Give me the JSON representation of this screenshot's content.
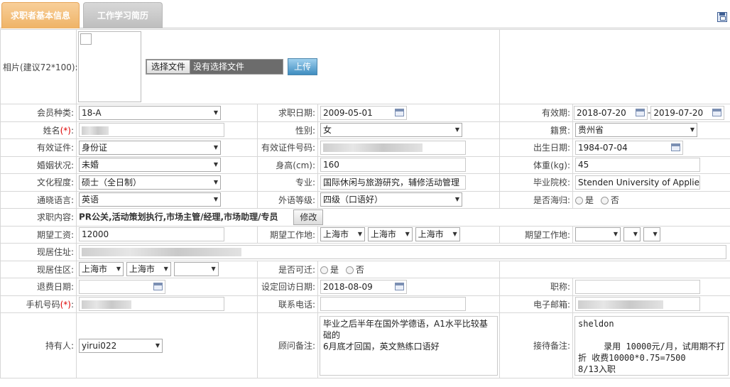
{
  "tabs": [
    "求职者基本信息",
    "工作学习简历"
  ],
  "labels": {
    "photo": "相片(建议72*100):",
    "member_type": "会员种类:",
    "job_date": "求职日期:",
    "validity": "有效期:",
    "name": "姓名",
    "gender": "性别:",
    "origin": "籍贯:",
    "id_type": "有效证件:",
    "id_number": "有效证件号码:",
    "birth": "出生日期:",
    "marital": "婚姻状况:",
    "height": "身高(cm):",
    "weight": "体重(kg):",
    "education": "文化程度:",
    "major": "专业:",
    "school": "毕业院校:",
    "language": "通晓语言:",
    "lang_level": "外语等级:",
    "returnee": "是否海归:",
    "job_content": "求职内容:",
    "salary": "期望工资:",
    "work_place": "期望工作地:",
    "work_place2": "期望工作地:",
    "address": "现居住址:",
    "district": "现居住区:",
    "relocate": "是否可迁:",
    "refund_date": "退费日期:",
    "revisit_date": "设定回访日期:",
    "title": "职称:",
    "mobile": "手机号码",
    "phone": "联系电话:",
    "email": "电子邮箱:",
    "owner": "持有人:",
    "advisor_note": "顾问备注:",
    "reception_note": "接待备注:"
  },
  "required_mark": "(*)",
  "photo": {
    "choose_file": "选择文件",
    "no_file": "没有选择文件",
    "upload": "上传"
  },
  "values": {
    "member_type": "18-A",
    "job_date": "2009-05-01",
    "validity_from": "2018-07-20",
    "validity_sep": "-",
    "validity_to": "2019-07-20",
    "gender": "女",
    "origin": "贵州省",
    "id_type": "身份证",
    "birth": "1984-07-04",
    "marital": "未婚",
    "height": "160",
    "weight": "45",
    "education": "硕士（全日制）",
    "major": "国际休闲与旅游研究，辅修活动管理",
    "school": "Stenden University of Applied",
    "language": "英语",
    "lang_level": "四级（口语好）",
    "job_content": "PR公关,活动策划执行,市场主管/经理,市场助理/专员",
    "modify": "修改",
    "salary": "12000",
    "work_place": [
      "上海市",
      "上海市",
      "上海市"
    ],
    "district": [
      "上海市",
      "上海市",
      ""
    ],
    "revisit_date": "2018-08-09",
    "owner": "yirui022",
    "advisor_note": "毕业之后半年在国外学德语，A1水平比较基础的\n6月底才回国，英文熟练口语好",
    "reception_note": "sheldon\n\n     录用 10000元/月，试用期不打折 收费10000*0.75=7500\n8/13入职"
  },
  "radio": {
    "yes": "是",
    "no": "否"
  }
}
